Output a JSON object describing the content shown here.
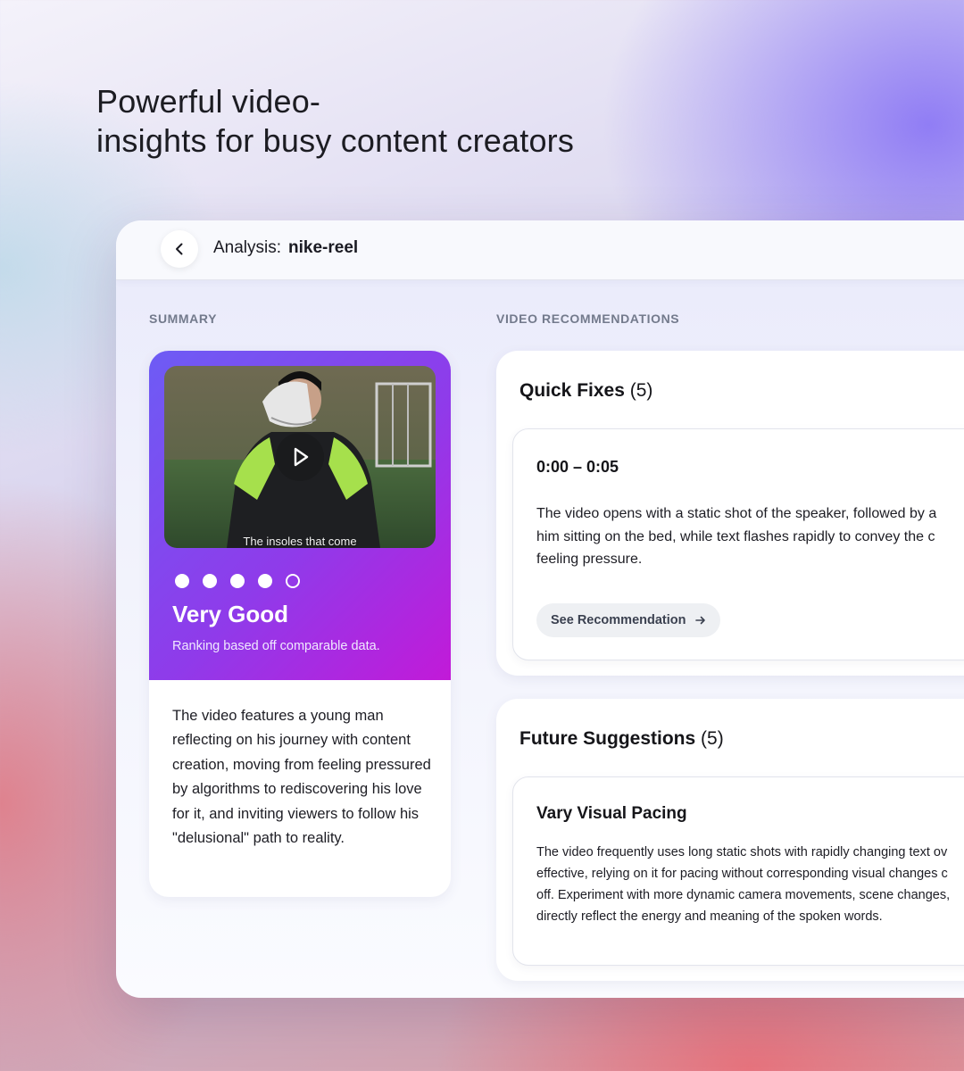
{
  "headline": {
    "line1": "Powerful video-",
    "line2": "insights for busy content creators"
  },
  "header": {
    "back_icon": "chevron-left-icon",
    "prefix": "Analysis:",
    "name": "nike-reel"
  },
  "summary": {
    "section_label": "SUMMARY",
    "video": {
      "caption": "The insoles that come",
      "play_icon": "play-icon"
    },
    "rating": {
      "score": 4,
      "max": 5,
      "label": "Very Good",
      "sub": "Ranking based off comparable data."
    },
    "description": "The video features a young man reflecting on his journey with content creation, moving from feeling pressured by algorithms to rediscovering his love for it, and inviting viewers to follow his \"delusional\" path to reality."
  },
  "recommendations": {
    "section_label": "VIDEO RECOMMENDATIONS",
    "quick_fixes": {
      "title": "Quick Fixes",
      "count": "(5)",
      "item": {
        "time": "0:00 – 0:05",
        "lines": [
          "The video opens with a static shot of the speaker, followed by a",
          "him sitting on the bed, while text flashes rapidly to convey the c",
          "feeling pressure."
        ],
        "button": "See Recommendation",
        "button_icon": "arrow-right-icon"
      }
    },
    "future_suggestions": {
      "title": "Future Suggestions",
      "count": "(5)",
      "item": {
        "title": "Vary Visual Pacing",
        "lines": [
          "The video frequently uses long static shots with rapidly changing text ov",
          "effective, relying on it for pacing without corresponding visual changes c",
          "off. Experiment with more dynamic camera movements, scene changes,",
          "directly reflect the energy and meaning of the spoken words."
        ]
      }
    }
  },
  "colors": {
    "accent_start": "#6d5cf5",
    "accent_end": "#c21ad8",
    "section_label": "#737a8c"
  }
}
